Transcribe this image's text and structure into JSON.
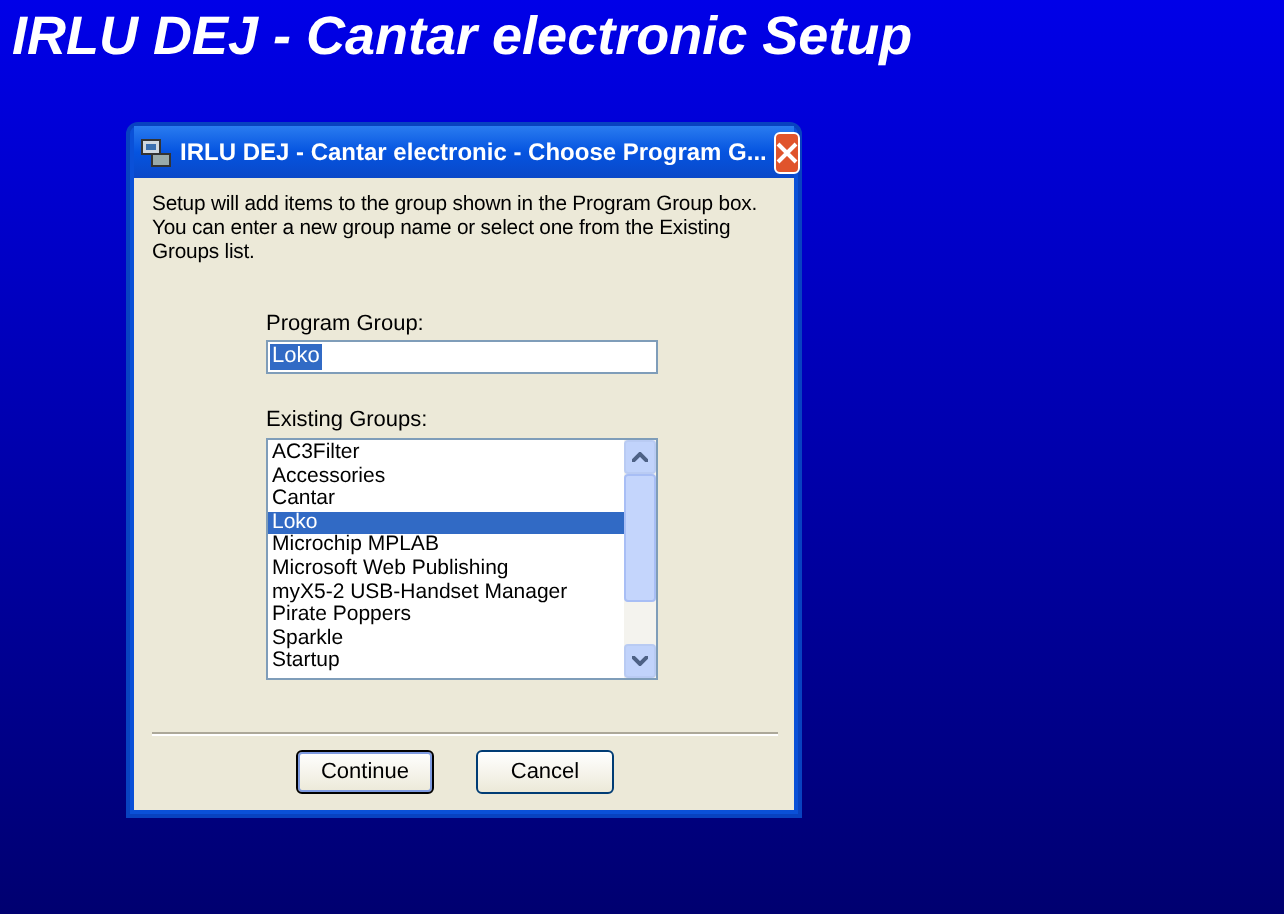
{
  "screen_title": "IRLU DEJ - Cantar electronic Setup",
  "dialog": {
    "title": "IRLU DEJ - Cantar electronic - Choose Program G...",
    "description": "Setup will add items to the group shown in the Program Group box. You can enter a new group name or select one from the Existing Groups list.",
    "program_group": {
      "label": "Program Group:",
      "value": "Loko"
    },
    "existing_groups": {
      "label": "Existing Groups:",
      "items": [
        {
          "text": "AC3Filter",
          "selected": false
        },
        {
          "text": "Accessories",
          "selected": false
        },
        {
          "text": "Cantar",
          "selected": false
        },
        {
          "text": "Loko",
          "selected": true
        },
        {
          "text": "Microchip MPLAB",
          "selected": false
        },
        {
          "text": "Microsoft Web Publishing",
          "selected": false
        },
        {
          "text": "myX5-2 USB-Handset Manager",
          "selected": false
        },
        {
          "text": "Pirate Poppers",
          "selected": false
        },
        {
          "text": "Sparkle",
          "selected": false
        },
        {
          "text": "Startup",
          "selected": false
        }
      ]
    },
    "buttons": [
      {
        "label": "Continue",
        "default": true
      },
      {
        "label": "Cancel",
        "default": false
      }
    ]
  }
}
